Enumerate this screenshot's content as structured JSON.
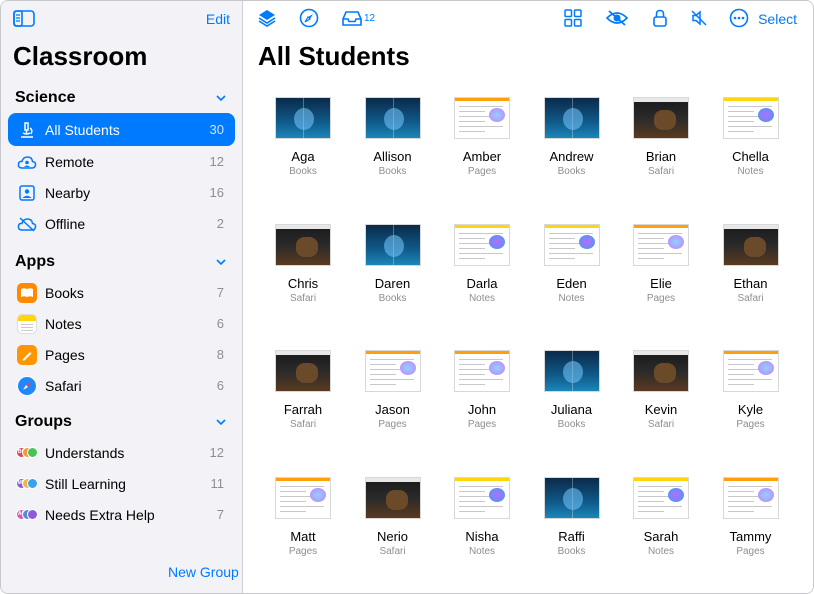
{
  "sidebar": {
    "edit_label": "Edit",
    "title": "Classroom",
    "sections": {
      "science": {
        "label": "Science",
        "items": [
          {
            "label": "All Students",
            "count": "30"
          },
          {
            "label": "Remote",
            "count": "12"
          },
          {
            "label": "Nearby",
            "count": "16"
          },
          {
            "label": "Offline",
            "count": "2"
          }
        ]
      },
      "apps": {
        "label": "Apps",
        "items": [
          {
            "label": "Books",
            "count": "7"
          },
          {
            "label": "Notes",
            "count": "6"
          },
          {
            "label": "Pages",
            "count": "8"
          },
          {
            "label": "Safari",
            "count": "6"
          }
        ]
      },
      "groups": {
        "label": "Groups",
        "items": [
          {
            "label": "Understands",
            "count": "12",
            "badge": "BC"
          },
          {
            "label": "Still Learning",
            "count": "11",
            "badge": "MR"
          },
          {
            "label": "Needs Extra Help",
            "count": "7",
            "badge": "AC"
          }
        ]
      }
    },
    "new_group_label": "New Group"
  },
  "toolbar": {
    "inbox_count": "12",
    "select_label": "Select"
  },
  "main": {
    "title": "All Students",
    "students": [
      {
        "name": "Aga",
        "app": "Books"
      },
      {
        "name": "Allison",
        "app": "Books"
      },
      {
        "name": "Amber",
        "app": "Pages"
      },
      {
        "name": "Andrew",
        "app": "Books"
      },
      {
        "name": "Brian",
        "app": "Safari"
      },
      {
        "name": "Chella",
        "app": "Notes"
      },
      {
        "name": "Chris",
        "app": "Safari"
      },
      {
        "name": "Daren",
        "app": "Books"
      },
      {
        "name": "Darla",
        "app": "Notes"
      },
      {
        "name": "Eden",
        "app": "Notes"
      },
      {
        "name": "Elie",
        "app": "Pages"
      },
      {
        "name": "Ethan",
        "app": "Safari"
      },
      {
        "name": "Farrah",
        "app": "Safari"
      },
      {
        "name": "Jason",
        "app": "Pages"
      },
      {
        "name": "John",
        "app": "Pages"
      },
      {
        "name": "Juliana",
        "app": "Books"
      },
      {
        "name": "Kevin",
        "app": "Safari"
      },
      {
        "name": "Kyle",
        "app": "Pages"
      },
      {
        "name": "Matt",
        "app": "Pages"
      },
      {
        "name": "Nerio",
        "app": "Safari"
      },
      {
        "name": "Nisha",
        "app": "Notes"
      },
      {
        "name": "Raffi",
        "app": "Books"
      },
      {
        "name": "Sarah",
        "app": "Notes"
      },
      {
        "name": "Tammy",
        "app": "Pages"
      }
    ]
  },
  "colors": {
    "accent": "#007aff",
    "books": "#ff9500",
    "notes": "#ffd60a",
    "pages": "#ff9f0a",
    "safari": "#1e88ff"
  }
}
